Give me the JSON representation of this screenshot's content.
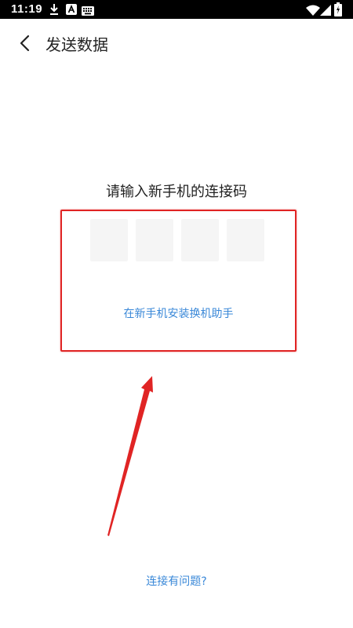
{
  "status_bar": {
    "time": "11:19",
    "left_icons": [
      "download-icon",
      "a-square-icon",
      "keyboard-icon"
    ],
    "right_icons": [
      "wifi-icon",
      "signal-icon",
      "battery-icon"
    ]
  },
  "header": {
    "back_icon": "chevron-left-icon",
    "title": "发送数据"
  },
  "main": {
    "prompt": "请输入新手机的连接码",
    "code_digits": [
      "",
      "",
      "",
      ""
    ],
    "install_link": "在新手机安装换机助手",
    "help_link": "连接有问题?"
  },
  "colors": {
    "link": "#3a88d8",
    "annotation_red": "#e02424",
    "code_box_bg": "#f5f5f5"
  }
}
